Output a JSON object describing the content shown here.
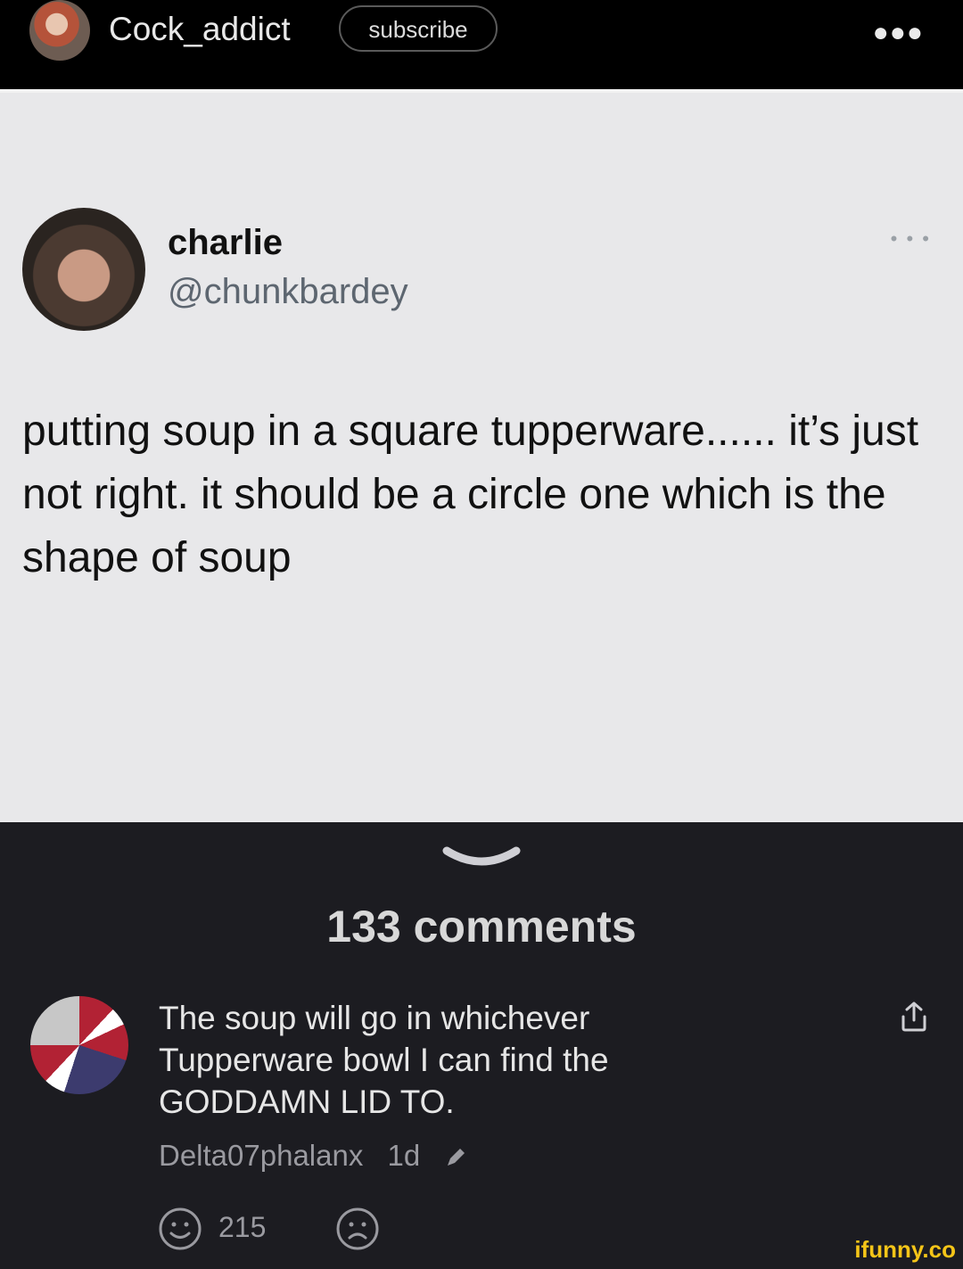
{
  "header": {
    "username": "Cock_addict",
    "subscribe_label": "subscribe",
    "more_glyph": "●●●"
  },
  "tweet": {
    "name": "charlie",
    "handle": "@chunkbardey",
    "more_glyph": "• • •",
    "text": "putting soup in a square tupperware...... it’s just not right. it should be a circle one which is the shape of soup"
  },
  "comments": {
    "title": "133 comments",
    "items": [
      {
        "text": "The soup will go in whichever Tupperware bowl I can find the GODDAMN LID TO.",
        "author": "Delta07phalanx",
        "age": "1d",
        "likes": "215"
      }
    ]
  },
  "watermark": "ifunny.co",
  "colors": {
    "header_bg": "#000000",
    "post_bg": "#e8e8ea",
    "comments_bg": "#1c1c21",
    "watermark": "#f5c518"
  },
  "icons": [
    "more-icon",
    "chevron-down-icon",
    "share-icon",
    "pencil-icon",
    "smile-icon",
    "frown-icon"
  ]
}
